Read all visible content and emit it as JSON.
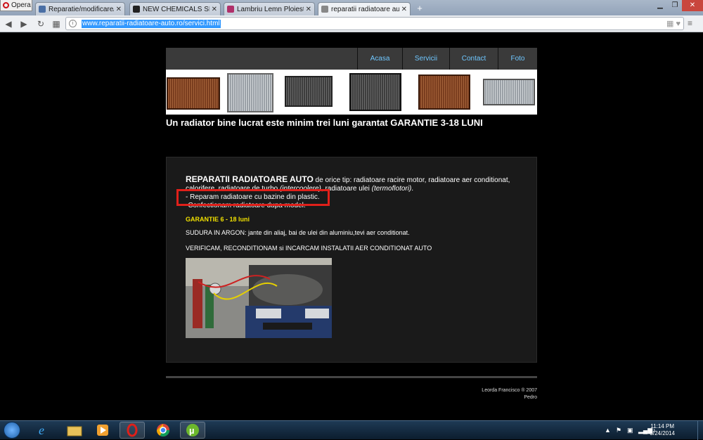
{
  "browser": {
    "menu_label": "Opera",
    "tabs": [
      {
        "title": "Reparatie/modificare/carp",
        "active": false,
        "favicon_color": "#4a6fa5"
      },
      {
        "title": "NEW CHEMICALS SRL",
        "active": false,
        "favicon_color": "#222222"
      },
      {
        "title": "Lambriu Lemn Ploiesti - B",
        "active": false,
        "favicon_color": "#b0306a"
      },
      {
        "title": "reparatii radiatoare auto",
        "active": true,
        "favicon_color": "#888888"
      }
    ],
    "new_tab": "+",
    "address": "www.reparatii-radiatoare-auto.ro/servici.html"
  },
  "site": {
    "nav": [
      {
        "label": "Acasa"
      },
      {
        "label": "Servicii"
      },
      {
        "label": "Contact"
      },
      {
        "label": "Foto"
      }
    ],
    "tagline": "Un radiator bine lucrat este minim trei luni garantat GARANTIE 3-18 LUNI",
    "intro": {
      "strong": "REPARATII RADIATOARE AUTO",
      "text1": " de orice tip: radiatoare racire motor, radiatoare aer conditionat,",
      "text2": "calorifere, radiatoare de turbo ",
      "intercooler": "(intercoolere)",
      "text3": ", radiatoare ulei ",
      "termo": "(termoflotori)",
      "text4": ".",
      "line2": "- Reparam radiatoare cu bazine din plastic.",
      "line3": "-Confectionam radiatoare dupa model."
    },
    "guarantee": "GARANTIE 6 - 18 luni",
    "sudura": "SUDURA IN ARGON: jante din aliaj, bai de ulei din aluminiu,tevi aer conditionat.",
    "verificam": "VERIFICAM, RECONDITIONAM si INCARCAM INSTALATII AER CONDITIONAT AUTO",
    "footer_copy": "Leorda Francisco ® 2007",
    "footer_author": "Pedro",
    "colors": {
      "nav_text": "#6fc7ff",
      "guarantee": "#f0e000",
      "highlight_box": "#e0201a"
    }
  },
  "taskbar": {
    "time": "11:14 PM",
    "date": "3/24/2014"
  }
}
